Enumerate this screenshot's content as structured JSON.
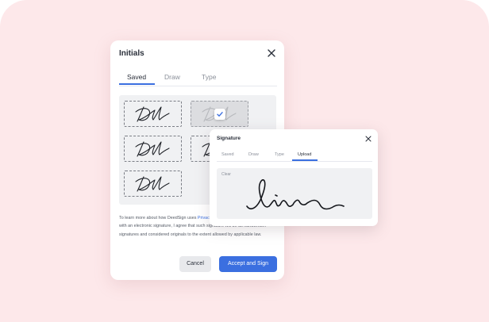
{
  "initials_dialog": {
    "title": "Initials",
    "tabs": [
      {
        "label": "Saved",
        "active": true
      },
      {
        "label": "Draw",
        "active": false
      },
      {
        "label": "Type",
        "active": false
      }
    ],
    "legal": {
      "before": "To learn more about how DeedSign uses",
      "link": "Privacy Policy",
      "after": ". By signing this document with an electronic signature, I agree that such signature will be as handwritten signatures and considered originals to the extent allowed by applicable law."
    },
    "cancel_label": "Cancel",
    "accept_label": "Accept and Sign"
  },
  "signature_dialog": {
    "title": "Signature",
    "tabs": [
      {
        "label": "Saved",
        "active": false
      },
      {
        "label": "Draw",
        "active": false
      },
      {
        "label": "Type",
        "active": false
      },
      {
        "label": "Upload",
        "active": true
      }
    ],
    "clear_label": "Clear"
  },
  "colors": {
    "accent": "#3b6fe0",
    "background": "#fde8ea"
  },
  "icons": {
    "close": "close-icon",
    "check": "check-icon"
  }
}
